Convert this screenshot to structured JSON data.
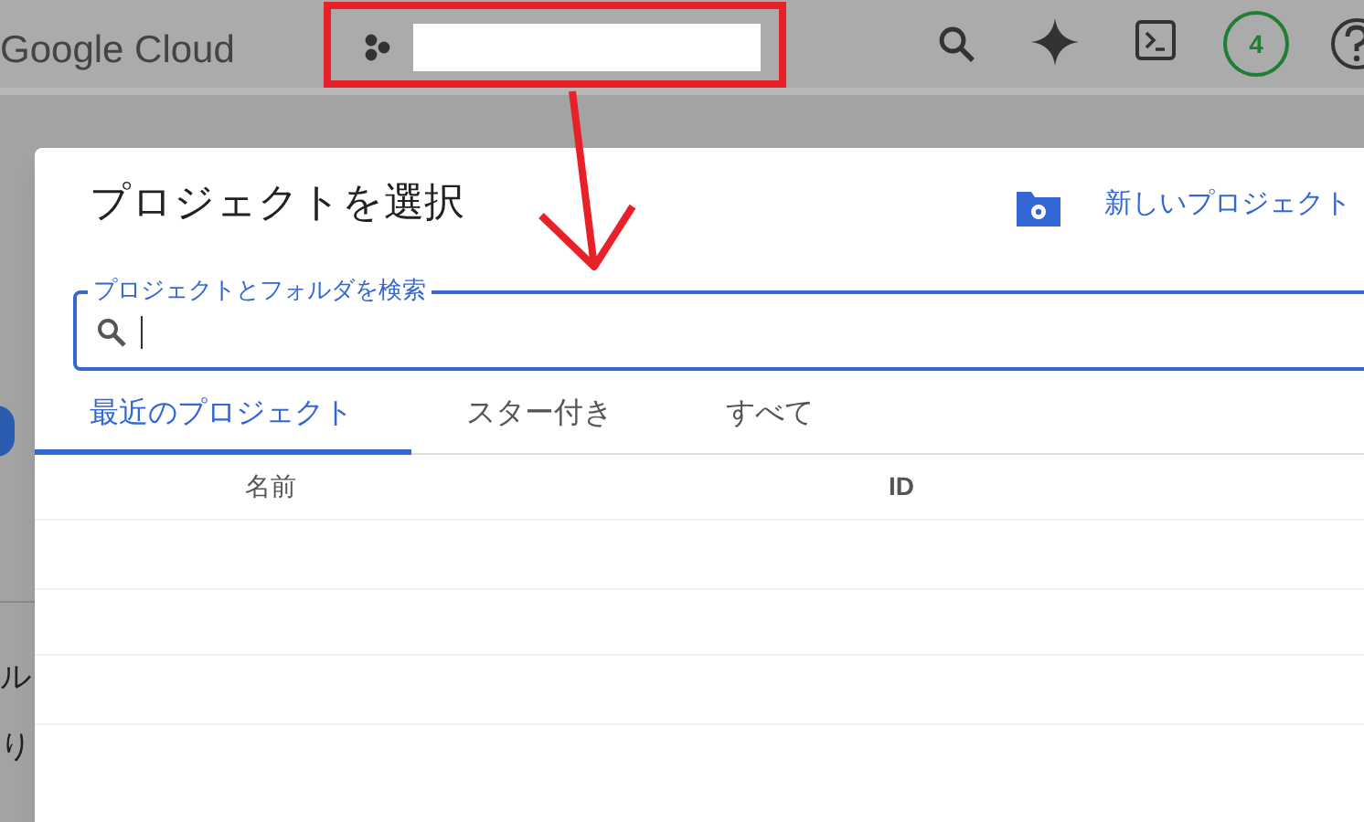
{
  "header": {
    "logo": "Google Cloud",
    "notification_count": "4"
  },
  "page_behind": {
    "texts": [
      "ル",
      "り"
    ]
  },
  "dialog": {
    "title": "プロジェクトを選択",
    "new_project": "新しいプロジェクト",
    "search": {
      "label": "プロジェクトとフォルダを検索"
    },
    "tabs": [
      {
        "label": "最近のプロジェクト",
        "selected": true
      },
      {
        "label": "スター付き",
        "selected": false
      },
      {
        "label": "すべて",
        "selected": false
      }
    ],
    "table": {
      "columns": [
        "名前",
        "ID"
      ]
    }
  }
}
